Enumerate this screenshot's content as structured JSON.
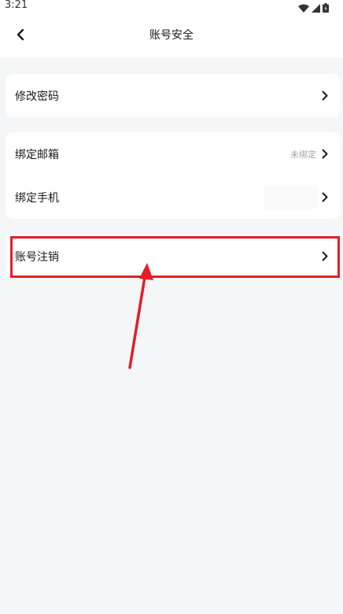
{
  "status_bar": {
    "time": "3:21"
  },
  "header": {
    "title": "账号安全"
  },
  "sections": {
    "password": {
      "label": "修改密码"
    },
    "binding": {
      "email_label": "绑定邮箱",
      "email_value": "未绑定",
      "phone_label": "绑定手机"
    },
    "deactivate": {
      "label": "账号注销"
    }
  },
  "colors": {
    "highlight": "#e41e25",
    "background": "#f5f6f8",
    "card": "#ffffff"
  }
}
